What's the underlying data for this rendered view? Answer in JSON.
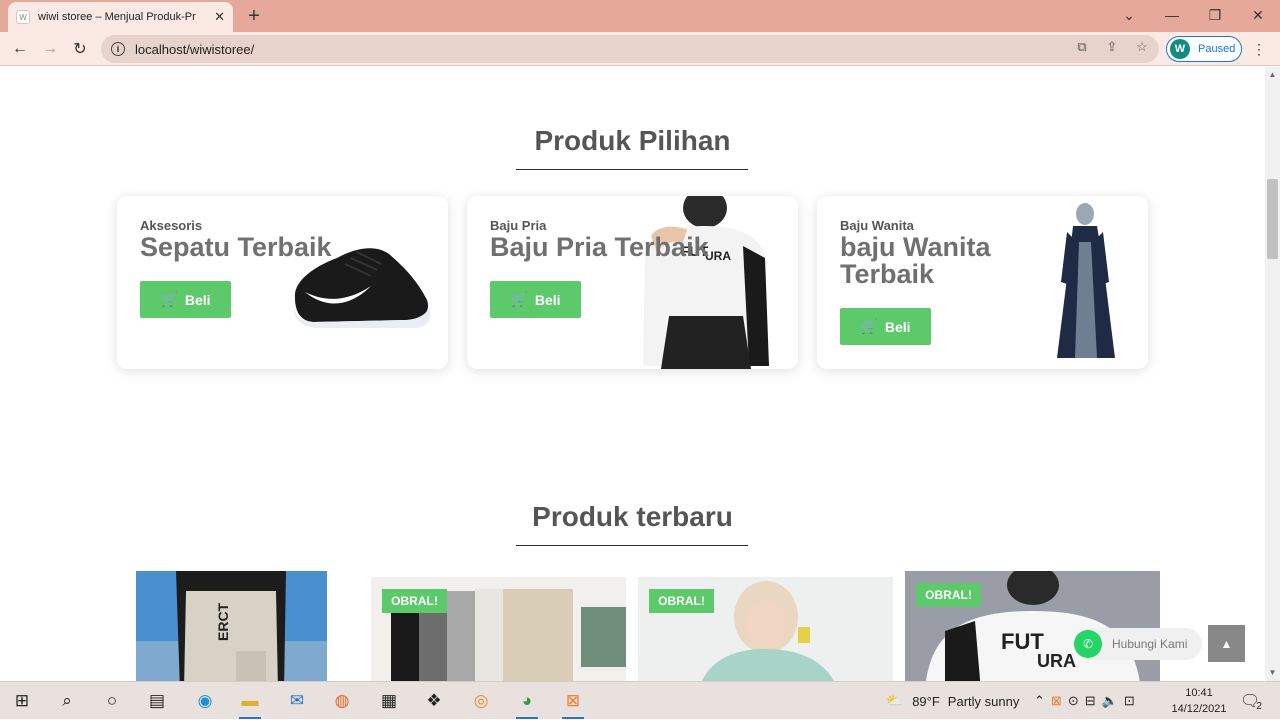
{
  "browser": {
    "tab_title": "wiwi storee – Menjual Produk-Pr",
    "tab_favicon": "W",
    "url": "localhost/wiwistoree/",
    "profile_initial": "W",
    "profile_status": "Paused"
  },
  "featured": {
    "title": "Produk Pilihan",
    "buy_label": "Beli",
    "cards": [
      {
        "category": "Aksesoris",
        "name": "Sepatu Terbaik"
      },
      {
        "category": "Baju Pria",
        "name": "Baju Pria Terbaik"
      },
      {
        "category": "Baju Wanita",
        "name": "baju Wanita Terbaik"
      }
    ]
  },
  "latest": {
    "title": "Produk terbaru",
    "sale_badge": "OBRAL!",
    "tshirt_text_1": "FUT",
    "tshirt_text_2": "URA",
    "pants_text": "ERCT"
  },
  "whatsapp": {
    "label": "Hubungi Kami"
  },
  "taskbar": {
    "temperature": "89°F",
    "weather": "Partly sunny",
    "time": "10:41",
    "date": "14/12/2021",
    "notifications": "2"
  },
  "colors": {
    "accent": "#5cc96a",
    "tabbar": "#e6a898",
    "toolbar": "#fbe9e3"
  }
}
